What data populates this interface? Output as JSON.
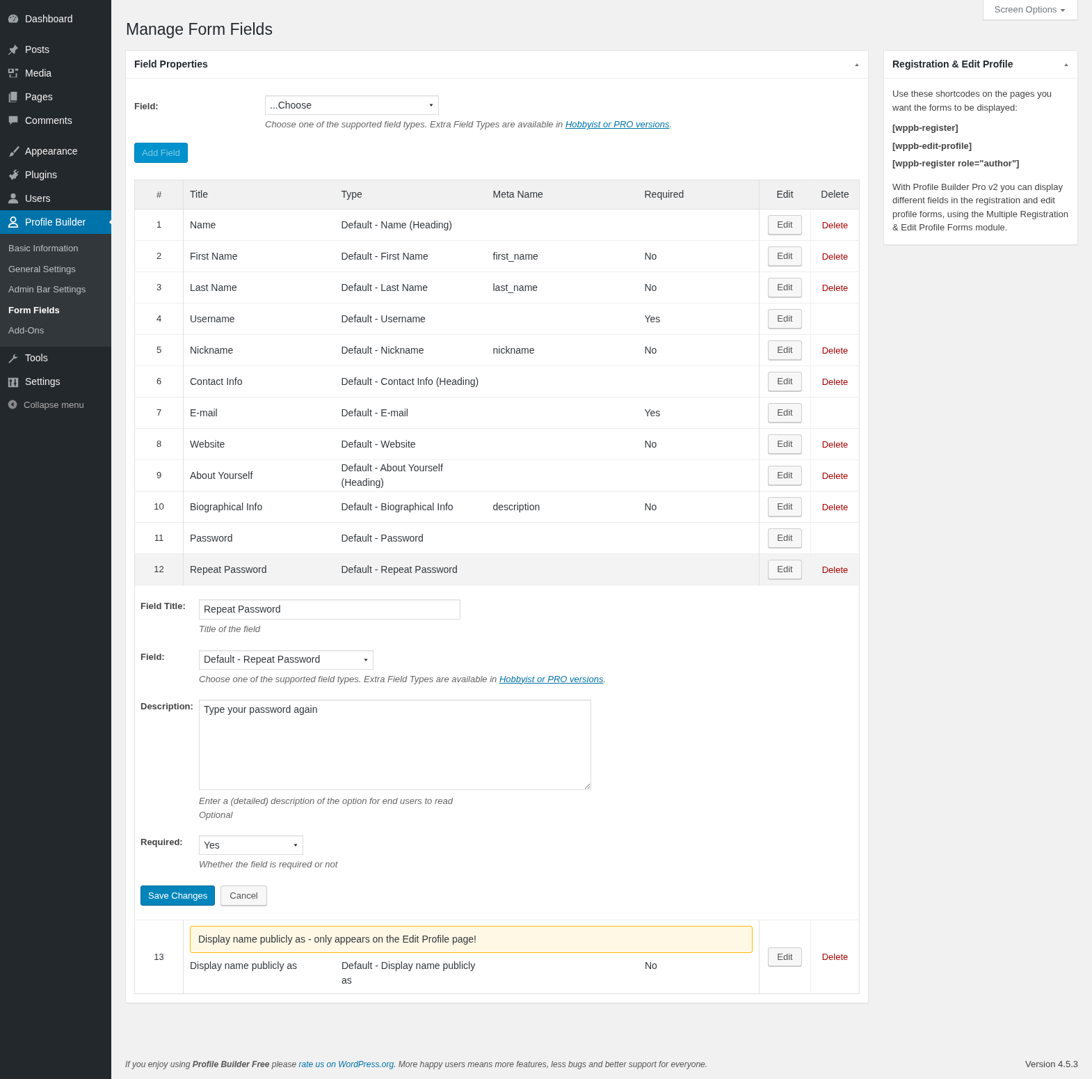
{
  "sidebar": {
    "menu": [
      {
        "label": "Dashboard",
        "current": false
      },
      {
        "label": "Posts",
        "current": false
      },
      {
        "label": "Media",
        "current": false
      },
      {
        "label": "Pages",
        "current": false
      },
      {
        "label": "Comments",
        "current": false
      },
      {
        "label": "Appearance",
        "current": false
      },
      {
        "label": "Plugins",
        "current": false
      },
      {
        "label": "Users",
        "current": false
      },
      {
        "label": "Profile Builder",
        "current": true,
        "submenu": [
          {
            "label": "Basic Information",
            "selected": false
          },
          {
            "label": "General Settings",
            "selected": false
          },
          {
            "label": "Admin Bar Settings",
            "selected": false
          },
          {
            "label": "Form Fields",
            "selected": true
          },
          {
            "label": "Add-Ons",
            "selected": false
          }
        ]
      },
      {
        "label": "Tools",
        "current": false
      },
      {
        "label": "Settings",
        "current": false
      }
    ],
    "collapse": "Collapse menu"
  },
  "screen_options": "Screen Options",
  "page_title": "Manage Form Fields",
  "field_properties": {
    "title": "Field Properties",
    "field_label": "Field:",
    "select_value": "...Choose",
    "hint": "Choose one of the supported field types. Extra Field Types are available in ",
    "hint_link": "Hobbyist or PRO versions",
    "hint_end": ".",
    "add_button": {
      "label": "Add Field",
      "disabled": true
    },
    "table": {
      "columns": [
        "#",
        "Title",
        "Type",
        "Meta Name",
        "Required",
        "Edit",
        "Delete"
      ],
      "rows": [
        {
          "num": "1",
          "title": "Name",
          "type": "Default - Name (Heading)",
          "edit": "Edit",
          "delete": "Delete",
          "editing": false
        },
        {
          "num": "2",
          "title": "First Name",
          "type": "Default - First Name",
          "meta": "first_name",
          "required": "No",
          "edit": "Edit",
          "delete": "Delete",
          "editing": false
        },
        {
          "num": "3",
          "title": "Last Name",
          "type": "Default - Last Name",
          "meta": "last_name",
          "required": "No",
          "edit": "Edit",
          "delete": "Delete",
          "editing": false
        },
        {
          "num": "4",
          "title": "Username",
          "type": "Default - Username",
          "required": "Yes",
          "edit": "Edit",
          "editing": false
        },
        {
          "num": "5",
          "title": "Nickname",
          "type": "Default - Nickname",
          "meta": "nickname",
          "required": "No",
          "edit": "Edit",
          "delete": "Delete",
          "editing": false
        },
        {
          "num": "6",
          "title": "Contact Info",
          "type": "Default - Contact Info (Heading)",
          "edit": "Edit",
          "delete": "Delete",
          "editing": false
        },
        {
          "num": "7",
          "title": "E-mail",
          "type": "Default - E-mail",
          "required": "Yes",
          "edit": "Edit",
          "editing": false
        },
        {
          "num": "8",
          "title": "Website",
          "type": "Default - Website",
          "required": "No",
          "edit": "Edit",
          "delete": "Delete",
          "editing": false
        },
        {
          "num": "9",
          "title": "About Yourself",
          "type": "Default - About Yourself (Heading)",
          "edit": "Edit",
          "delete": "Delete",
          "editing": false
        },
        {
          "num": "10",
          "title": "Biographical Info",
          "type": "Default - Biographical Info",
          "meta": "description",
          "required": "No",
          "edit": "Edit",
          "delete": "Delete",
          "editing": false
        },
        {
          "num": "11",
          "title": "Password",
          "type": "Default - Password",
          "edit": "Edit",
          "editing": false
        },
        {
          "num": "12",
          "title": "Repeat Password",
          "type": "Default - Repeat Password",
          "edit": "Edit",
          "delete": "Delete",
          "editing": true
        },
        {
          "num": "13",
          "notice": "Display name publicly as - only appears on the Edit Profile page!",
          "title": "Display name publicly as",
          "type": "Default - Display name publicly as",
          "required": "No",
          "edit": "Edit",
          "delete": "Delete",
          "editing": false
        }
      ]
    },
    "edit_form": {
      "title_label": "Field Title:",
      "title_value": "Repeat Password",
      "title_hint": "Title of the field",
      "field_label": "Field:",
      "field_value": "Default - Repeat Password",
      "field_hint": "Choose one of the supported field types. Extra Field Types are available in ",
      "field_hint_link": "Hobbyist or PRO versions",
      "field_hint_end": ".",
      "description_label": "Description:",
      "description_value": "Type your password again",
      "description_hints": [
        "Enter a (detailed) description of the option for end users to read",
        "Optional"
      ],
      "required_label": "Required:",
      "required_value": "Yes",
      "required_hint": "Whether the field is required or not",
      "save": "Save Changes",
      "cancel": "Cancel"
    }
  },
  "side_box": {
    "title": "Registration & Edit Profile",
    "intro": "Use these shortcodes on the pages you want the forms to be displayed:",
    "shortcodes": [
      "[wppb-register]",
      "[wppb-edit-profile]",
      "[wppb-register role=\"author\"]"
    ],
    "note": "With Profile Builder Pro v2 you can display different fields in the registration and edit profile forms, using the Multiple Registration & Edit Profile Forms module."
  },
  "footer": {
    "before": "If you enjoy using **Profile Builder Free** please ",
    "link": "rate us on WordPress.org",
    "after": ". More happy users means more features, less bugs and better support for everyone.",
    "version": "Version 4.5.3"
  }
}
